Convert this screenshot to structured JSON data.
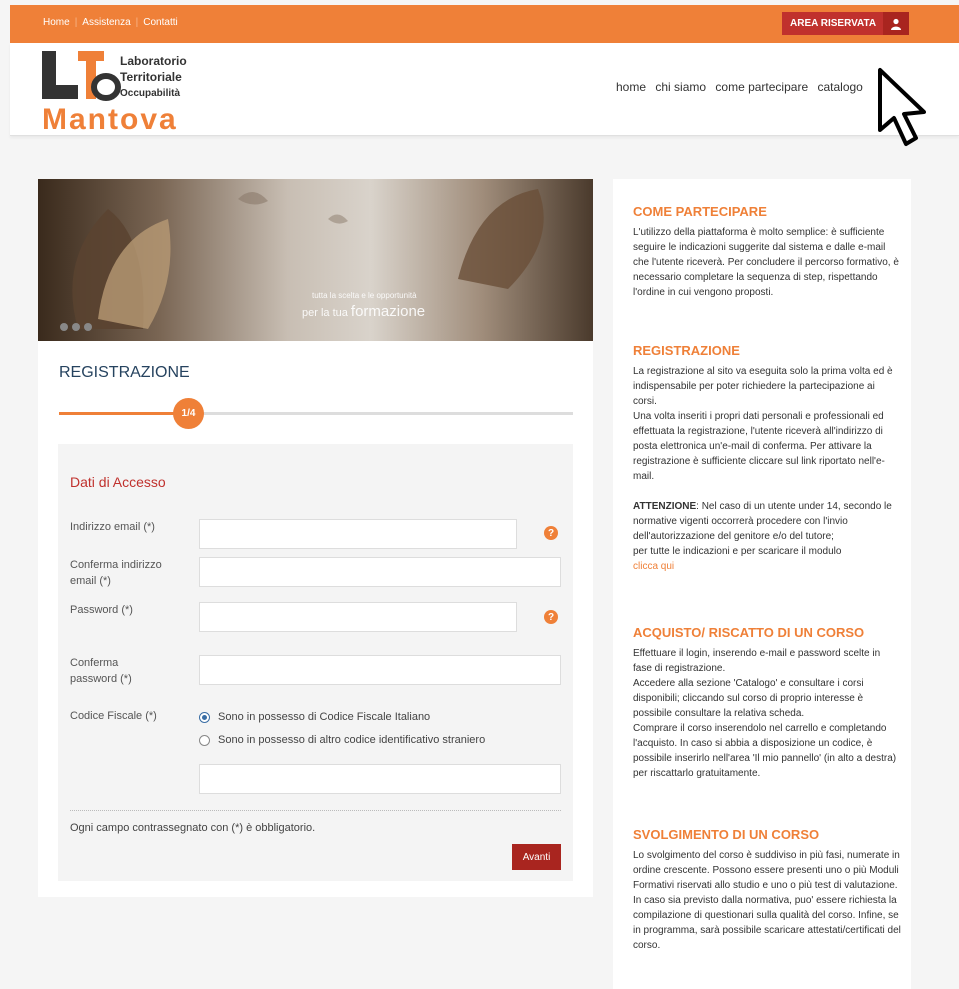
{
  "topbar": {
    "links": [
      "Home",
      "Assistenza",
      "Contatti"
    ],
    "area_button": "AREA RISERVATA",
    "area_icon": "user-icon"
  },
  "logo": {
    "line1": "Laboratorio",
    "line2": "Territoriale",
    "line3": "Occupabilità",
    "big": "Mantova",
    "initials": "LTO"
  },
  "nav": [
    "home",
    "chi siamo",
    "come partecipare",
    "catalogo"
  ],
  "banner": {
    "line1": "tutta la scelta e le opportunità",
    "line2_prefix": "per la tua ",
    "line2_big": "formazione",
    "slides": 3
  },
  "registration": {
    "title": "REGISTRAZIONE",
    "step": "1/4",
    "section_title": "Dati di Accesso",
    "fields": {
      "email": "Indirizzo email (*)",
      "email_confirm": "Conferma indirizzo email (*)",
      "password": "Password (*)",
      "password_confirm": "Conferma password (*)",
      "codice_fiscale": "Codice Fiscale (*)"
    },
    "radio_it": "Sono in possesso di Codice Fiscale Italiano",
    "radio_foreign": "Sono in possesso di altro codice identificativo straniero",
    "help_glyph": "?",
    "required_note": "Ogni campo contrassegnato con (*) è obbligatorio.",
    "next_button": "Avanti"
  },
  "sidebar": {
    "s1": {
      "title": "COME PARTECIPARE",
      "text": "L'utilizzo della piattaforma è molto semplice: è sufficiente seguire le indicazioni suggerite dal sistema e dalle e-mail che l'utente riceverà. Per concludere il percorso formativo, è necessario completare la sequenza di step, rispettando l'ordine in cui vengono proposti."
    },
    "s2": {
      "title": "REGISTRAZIONE",
      "p1": "La registrazione al sito va eseguita solo la prima volta ed è indispensabile per poter richiedere la partecipazione ai corsi.",
      "p2": "Una volta inseriti i propri dati personali e professionali ed effettuata la registrazione, l'utente riceverà all'indirizzo di posta elettronica un'e-mail di conferma. Per attivare la registrazione è sufficiente cliccare sul link riportato nell'e-mail.",
      "attn_label": "ATTENZIONE",
      "attn_text": ": Nel caso di un utente under 14, secondo le normative vigenti occorrerà procedere con l'invio dell'autorizzazione del genitore e/o del tutore;",
      "p3": "per tutte le indicazioni e per scaricare il modulo",
      "link": "clicca qui"
    },
    "s3": {
      "title": "ACQUISTO/ RISCATTO DI UN CORSO",
      "p1": "Effettuare il login, inserendo e-mail e password scelte in fase di registrazione.",
      "p2": "Accedere alla sezione 'Catalogo' e consultare i corsi disponibili; cliccando sul corso di proprio interesse è possibile consultare la relativa scheda.",
      "p3": "Comprare il corso inserendolo nel carrello e completando l'acquisto. In caso si abbia a disposizione un codice, è possibile inserirlo nell'area 'Il mio pannello' (in alto a destra) per riscattarlo gratuitamente."
    },
    "s4": {
      "title": "SVOLGIMENTO DI UN CORSO",
      "p1": "Lo svolgimento del corso è suddiviso in più fasi, numerate in ordine crescente. Possono essere presenti uno o più Moduli Formativi riservati allo studio e uno o più test di valutazione.",
      "p2": "In caso sia previsto dalla normativa, puo' essere richiesta la compilazione di questionari sulla qualità del corso. Infine, se in programma, sarà possibile scaricare attestati/certificati del corso."
    }
  },
  "colors": {
    "accent": "#ef8038",
    "dark_red": "#c0312d",
    "navy": "#26435f"
  }
}
